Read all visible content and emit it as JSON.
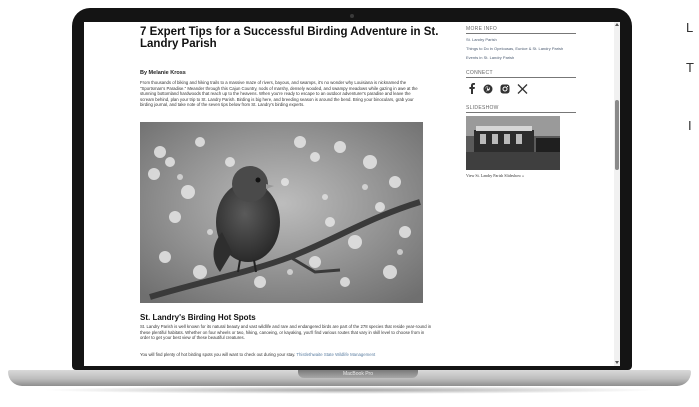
{
  "article": {
    "title": "7 Expert Tips for a Successful Birding Adventure in St. Landry Parish",
    "byline": "By Melanie Kross",
    "intro": "From thousands of biking and hiking trails to a massive maze of rivers, bayous, and swamps, it's no wonder why Louisiana is nicknamed the \"Sportsman's Paradise.\" Meander through this Cajun Country, nods of marshy, densely wooded, and swampy meadows while gazing in awe at the stunning bottomland hardwoods that reach up to the heavens. When you're ready to escape to an outdoor adventurer's paradise and leave the scream behind, plan your trip to St. Landry Parish. Birding is big here, and breeding season is around the bend. Bring your binoculars, grab your birding journal, and take note of the seven tips below from St. Landry's birding experts.",
    "section_heading": "St. Landry's Birding Hot Spots",
    "section_body": "St. Landry Parish is well known for its natural beauty and vast wildlife and rare and endangered birds are part of the 278 species that reside year-round in these plentiful habitats. Whether on four wheels or two, hiking, canoeing, or kayaking, you'll find various routes that vary in skill level to choose from in order to get your best view of these beautiful creatures.",
    "section_body2_start": "You will find plenty of hot birding spots you will want to check out during your stay.",
    "section_body2_link": "Thistlethwaite State Wildlife Management"
  },
  "sidebar": {
    "more_info_heading": "MORE INFO",
    "links": [
      "St. Landry Parish",
      "Things to Do in Opelousas, Eunice & St. Landry Parish",
      "Events in St. Landry Parish"
    ],
    "connect_heading": "CONNECT",
    "social_icons": [
      "facebook-icon",
      "pinterest-icon",
      "instagram-icon",
      "x-icon"
    ],
    "slideshow_heading": "SLIDESHOW",
    "slideshow_caption": "View St. Landry Parish Slideshow »"
  },
  "device": {
    "label": "MacBook Pro"
  },
  "edge_text": {
    "line1": "L",
    "line2": "T",
    "line3": "I"
  }
}
